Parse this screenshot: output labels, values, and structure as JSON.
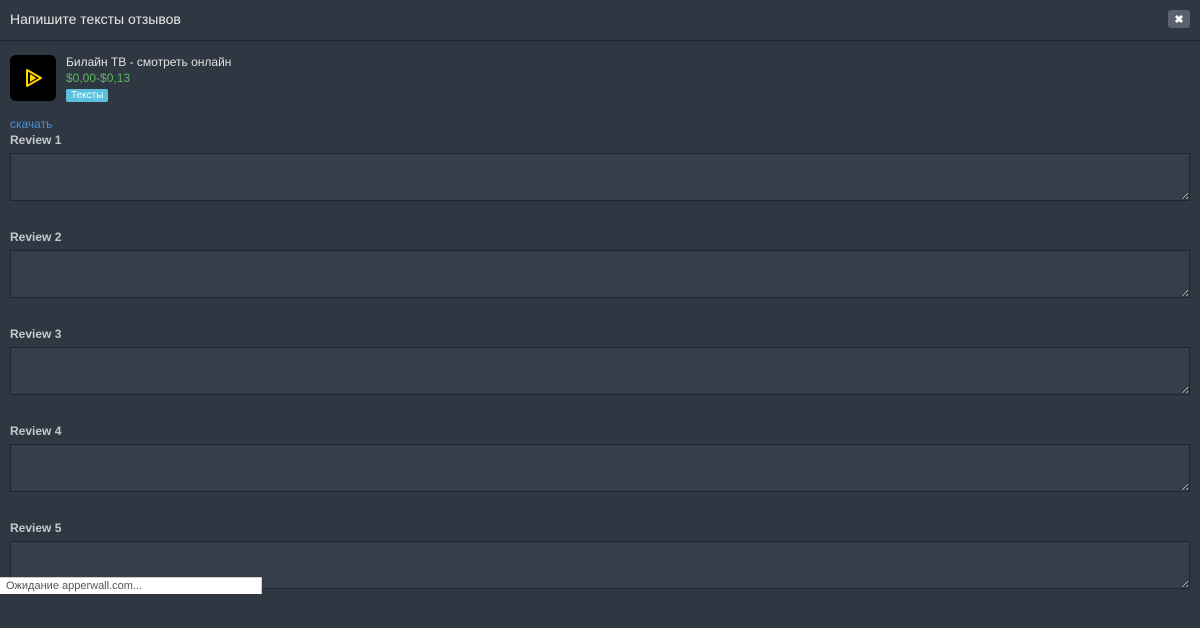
{
  "modal": {
    "title": "Напишите тексты отзывов"
  },
  "app": {
    "name": "Билайн ТВ - смотреть онлайн",
    "price": "$0,00-$0,13",
    "badge": "Тексты"
  },
  "download": {
    "label": "скачать"
  },
  "reviews": [
    {
      "label": "Review 1",
      "value": ""
    },
    {
      "label": "Review 2",
      "value": ""
    },
    {
      "label": "Review 3",
      "value": ""
    },
    {
      "label": "Review 4",
      "value": ""
    },
    {
      "label": "Review 5",
      "value": ""
    }
  ],
  "status": {
    "text": "Ожидание apperwall.com..."
  }
}
